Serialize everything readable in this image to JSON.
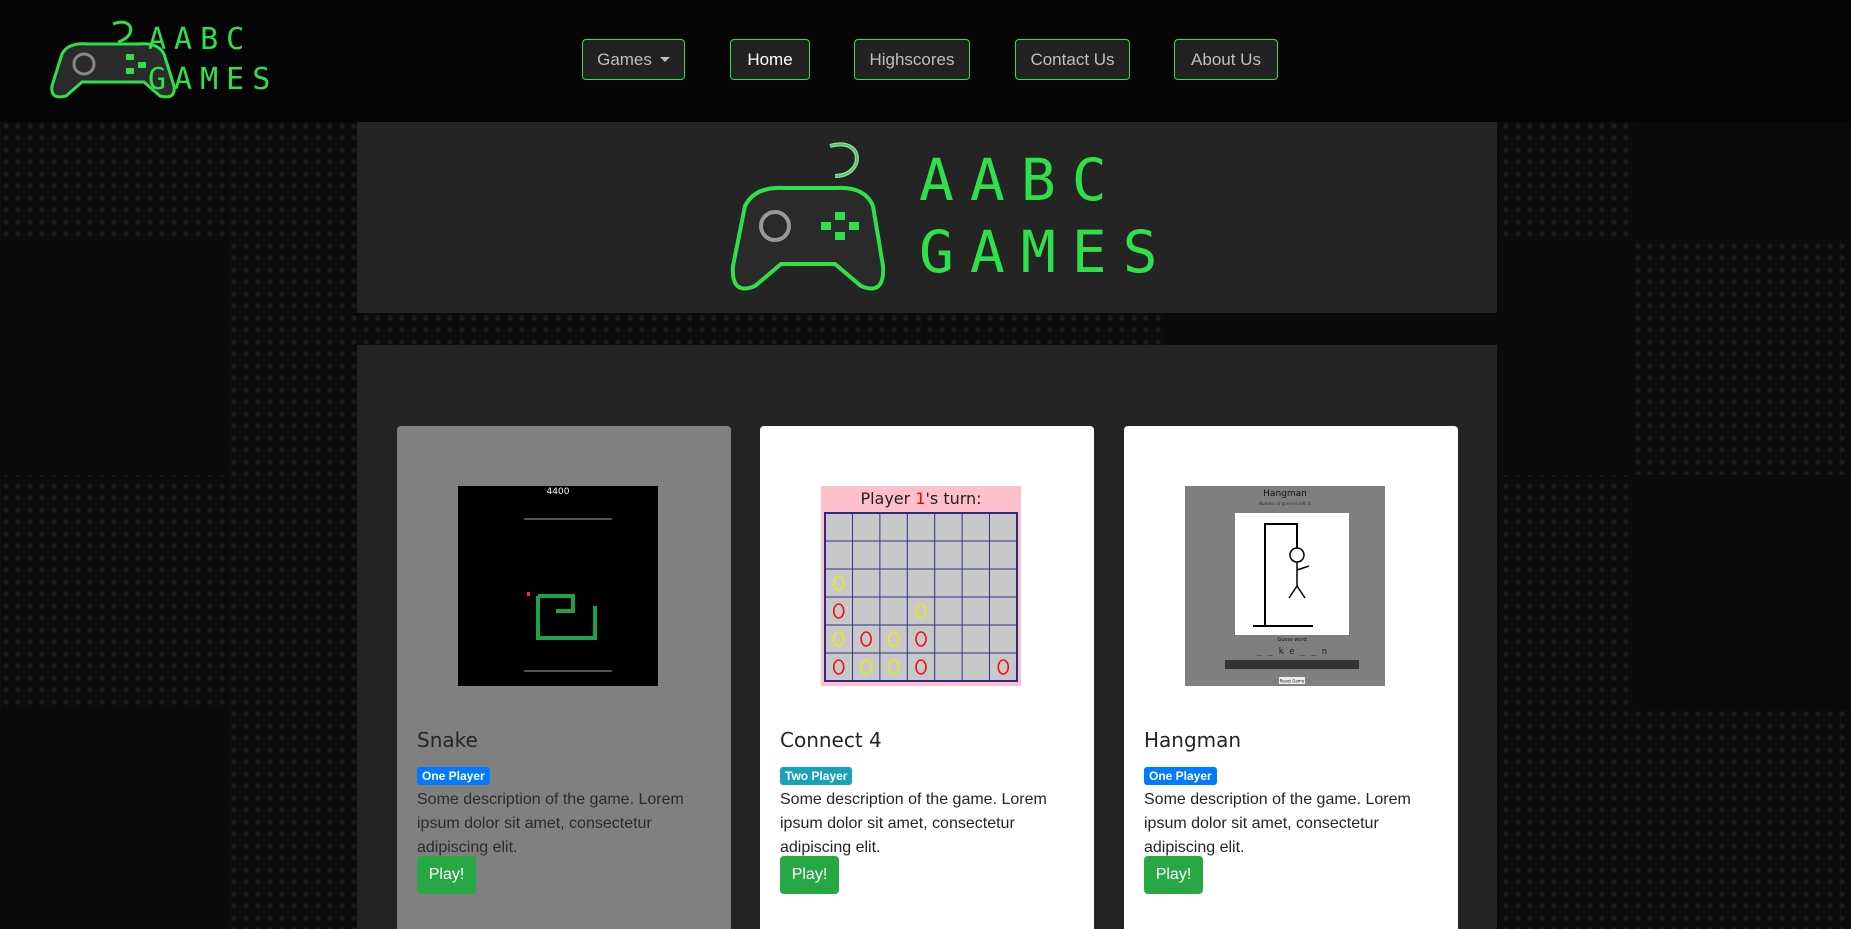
{
  "brand": {
    "line1": "AABC",
    "line2": "GAMES",
    "logo_icon": "gamepad-snake-icon"
  },
  "nav": {
    "games": "Games",
    "home": "Home",
    "highscores": "Highscores",
    "contact": "Contact Us",
    "about": "About Us"
  },
  "hero": {
    "line1": "AABC",
    "line2": "GAMES"
  },
  "games": [
    {
      "title": "Snake",
      "badge": "One Player",
      "description": "Some description of the game. Lorem ipsum dolor sit amet, consectetur adipiscing elit.",
      "play": "Play!",
      "preview": {
        "score": "4400"
      }
    },
    {
      "title": "Connect 4",
      "badge": "Two Player",
      "description": "Some description of the game. Lorem ipsum dolor sit amet, consectetur adipiscing elit.",
      "play": "Play!",
      "preview": {
        "turn_prefix": "Player ",
        "turn_player": "1",
        "turn_suffix": "'s turn:"
      }
    },
    {
      "title": "Hangman",
      "badge": "One Player",
      "description": "Some description of the game. Lorem ipsum dolor sit amet, consectetur adipiscing elit.",
      "play": "Play!",
      "preview": {
        "heading": "Hangman",
        "subheading": "Number of guesses left: 6",
        "guess_label": "Guess word",
        "word": "_ _ k e _ _ n",
        "button": "Reset Game"
      }
    }
  ],
  "colors": {
    "accent": "#2fe04a",
    "play": "#28a745",
    "badge_one": "#007bff",
    "badge_two": "#17a2b8"
  }
}
